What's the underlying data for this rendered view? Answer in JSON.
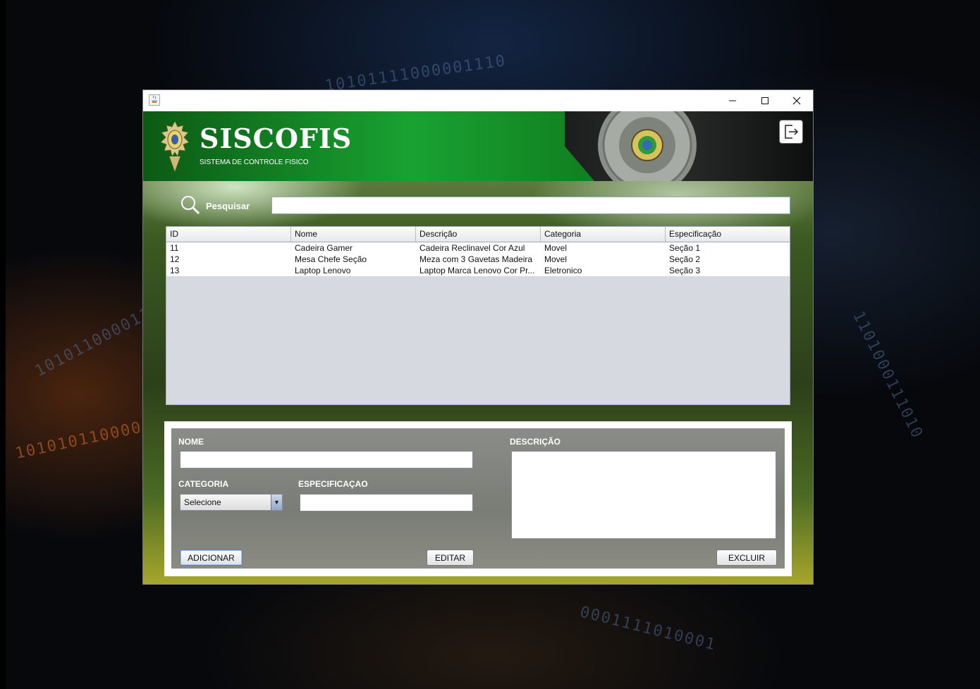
{
  "window": {
    "minimize_glyph": "—",
    "maximize_glyph": "☐",
    "close_glyph": "✕"
  },
  "header": {
    "title": "SISCOFIS",
    "subtitle": "SISTEMA DE CONTROLE FISICO",
    "logout_icon": "logout-icon"
  },
  "search": {
    "label": "Pesquisar",
    "value": "",
    "placeholder": ""
  },
  "table": {
    "columns": [
      "ID",
      "Nome",
      "Descrição",
      "Categoria",
      "Especificação"
    ],
    "rows": [
      [
        "11",
        "Cadeira Gamer",
        "Cadeira Reclinavel Cor Azul",
        "Movel",
        "Seção 1"
      ],
      [
        "12",
        "Mesa Chefe Seção",
        "Meza com 3 Gavetas Madeira",
        "Movel",
        "Seção 2"
      ],
      [
        "13",
        "Laptop Lenovo",
        "Laptop Marca Lenovo Cor Pr...",
        "Eletronico",
        "Seção 3"
      ]
    ]
  },
  "form": {
    "nome_label": "NOME",
    "nome_value": "",
    "descricao_label": "DESCRIÇÃO",
    "descricao_value": "",
    "categoria_label": "CATEGORIA",
    "categoria_selected": "Selecione",
    "especificacao_label": "ESPECIFICAÇAO",
    "especificacao_value": "",
    "add_button": "ADICIONAR",
    "edit_button": "EDITAR",
    "delete_button": "EXCLUIR"
  },
  "colors": {
    "header_green": "#19a231",
    "table_bg": "#d6d9e0",
    "form_bg": "#8a8c88"
  }
}
